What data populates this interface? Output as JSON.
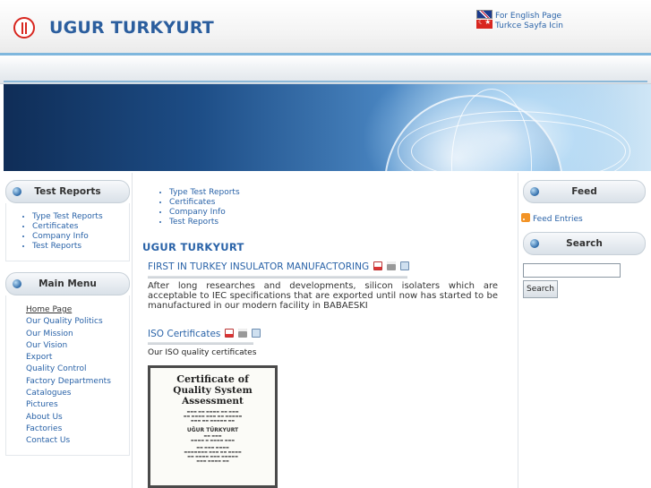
{
  "header": {
    "site_title": "UGUR TURKYURT",
    "lang_english": "For English Page",
    "lang_turkish": "Turkce Sayfa Icin"
  },
  "left": {
    "test_reports": {
      "title": "Test Reports",
      "items": [
        "Type Test Reports",
        "Certificates",
        "Company Info",
        "Test Reports"
      ]
    },
    "main_menu": {
      "title": "Main Menu",
      "items": [
        "Home Page",
        "Our Quality Politics",
        "Our Mission",
        "Our Vision",
        "Export",
        "Quality Control",
        "Factory Departments",
        "Catalogues",
        "Pictures",
        "About Us",
        "Factories",
        "Contact Us"
      ]
    }
  },
  "center": {
    "links": [
      "Type Test Reports",
      "Certificates",
      "Company Info",
      "Test Reports"
    ],
    "heading": "UGUR TURKYURT",
    "article1": {
      "title": "FIRST IN TURKEY INSULATOR MANUFACTORING",
      "text": "After long researches and developments, silicon isolaters which are acceptable to IEC specifications that are exported until now has started to be manufactured in our modern facility in BABAESKI"
    },
    "article2": {
      "title": "ISO Certificates",
      "text": "Our ISO quality certificates"
    },
    "certificate": {
      "line1": "Certificate of",
      "line2": "Quality System Assessment",
      "name": "UĞUR TÜRKYURT"
    }
  },
  "right": {
    "feed": {
      "title": "Feed",
      "link": "Feed Entries"
    },
    "search": {
      "title": "Search",
      "button": "Search"
    }
  },
  "colors": {
    "link": "#2a63a8",
    "title": "#2b5e9e",
    "accent": "#7fb7dd"
  }
}
